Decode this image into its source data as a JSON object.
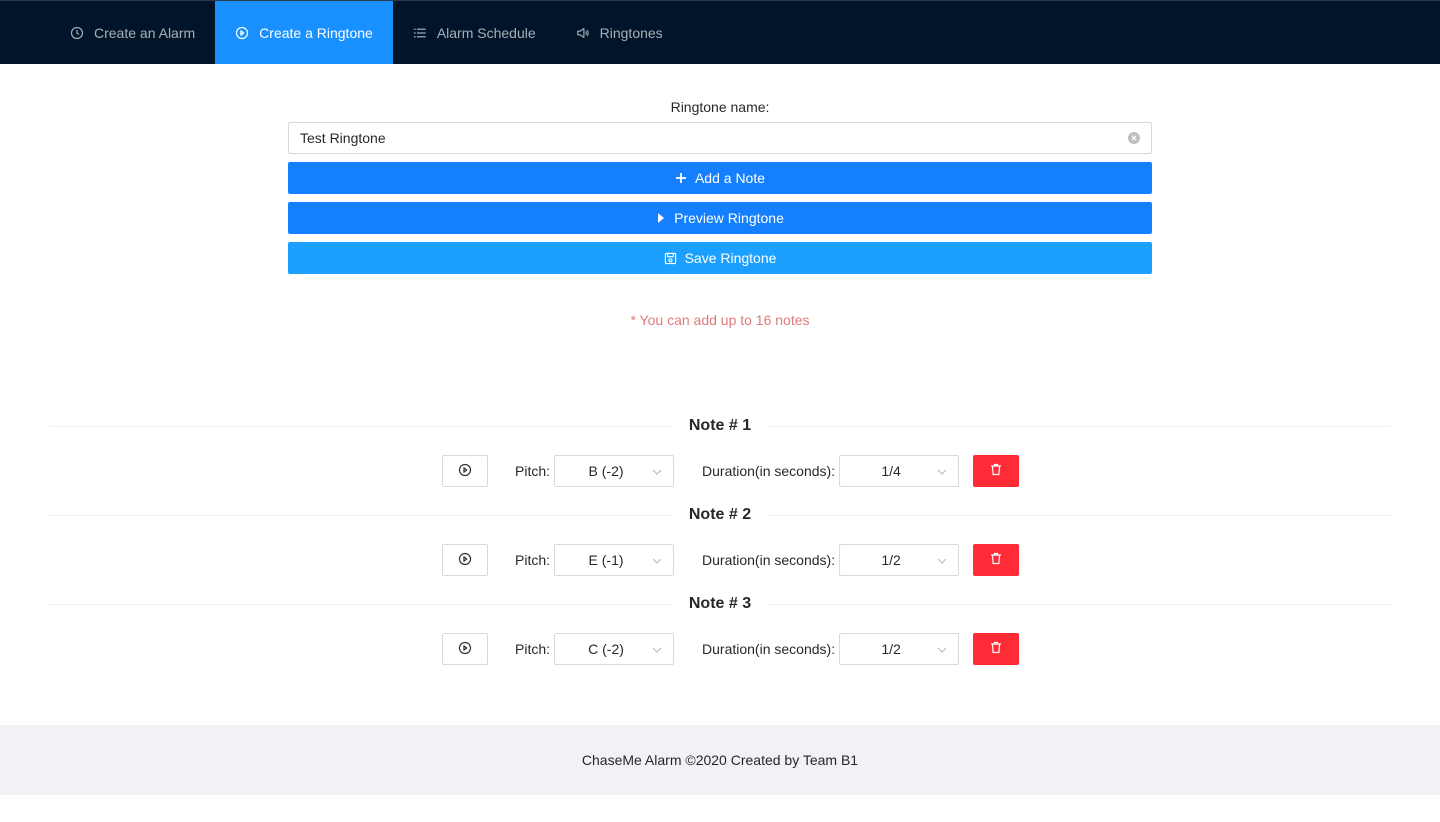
{
  "nav": {
    "items": [
      {
        "label": "Create an Alarm",
        "icon": "clock-icon",
        "active": false
      },
      {
        "label": "Create a Ringtone",
        "icon": "play-circle-icon",
        "active": true
      },
      {
        "label": "Alarm Schedule",
        "icon": "list-icon",
        "active": false
      },
      {
        "label": "Ringtones",
        "icon": "sound-icon",
        "active": false
      }
    ]
  },
  "form": {
    "name_label": "Ringtone name:",
    "name_value": "Test Ringtone",
    "add_note_label": "Add a Note",
    "preview_label": "Preview Ringtone",
    "save_label": "Save Ringtone",
    "hint": "* You can add up to 16 notes"
  },
  "notes": [
    {
      "title": "Note # 1",
      "pitch_label": "Pitch:",
      "pitch": "B (-2)",
      "duration_label": "Duration(in seconds):",
      "duration": "1/4"
    },
    {
      "title": "Note # 2",
      "pitch_label": "Pitch:",
      "pitch": "E (-1)",
      "duration_label": "Duration(in seconds):",
      "duration": "1/2"
    },
    {
      "title": "Note # 3",
      "pitch_label": "Pitch:",
      "pitch": "C (-2)",
      "duration_label": "Duration(in seconds):",
      "duration": "1/2"
    }
  ],
  "footer": {
    "text": "ChaseMe Alarm ©2020 Created by Team B1"
  },
  "colors": {
    "nav_bg": "#001529",
    "accent": "#1890ff",
    "danger": "#ff2b36",
    "hint": "#e07a7a"
  }
}
